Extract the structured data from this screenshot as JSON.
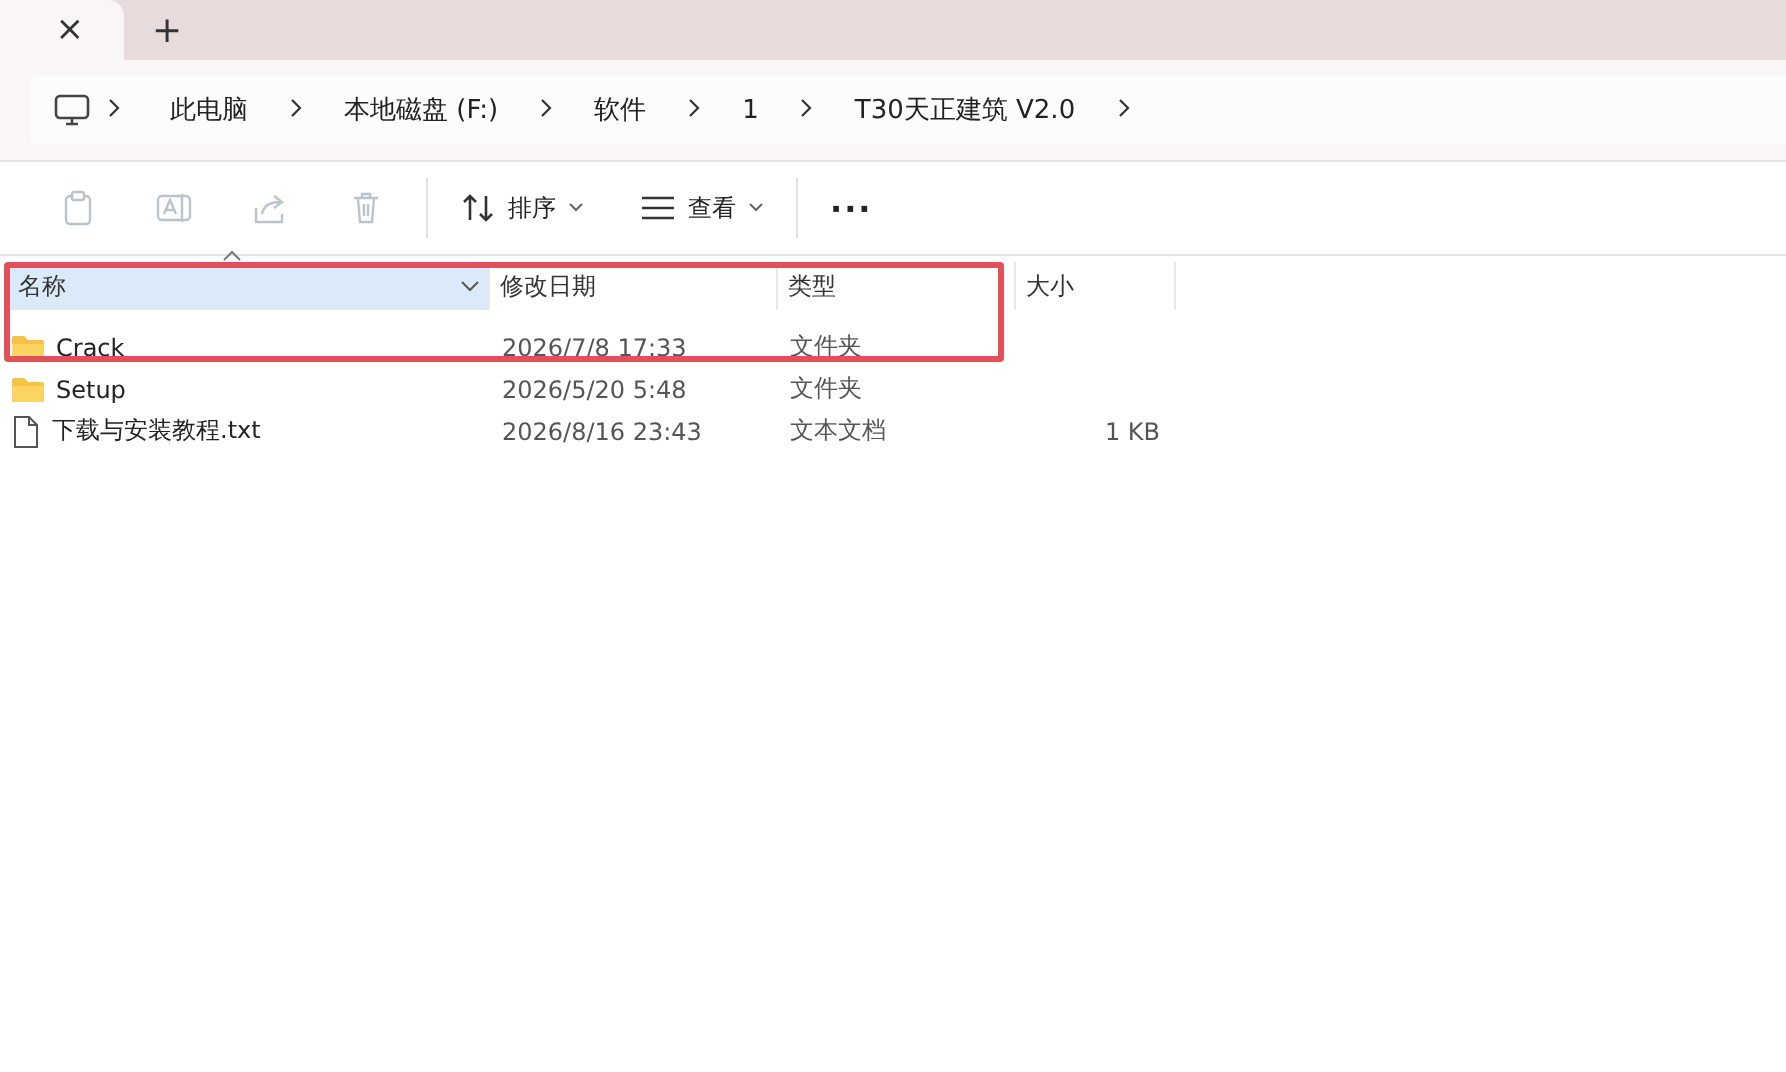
{
  "tabs": [
    {
      "close": "×",
      "selected": true
    }
  ],
  "new_tab": "+",
  "breadcrumb": [
    "此电脑",
    "本地磁盘 (F:)",
    "软件",
    "1",
    "T30天正建筑 V2.0"
  ],
  "toolbar": {
    "actions": [
      {
        "kind": "copy",
        "disabled": true
      },
      {
        "kind": "rename",
        "disabled": true
      },
      {
        "kind": "share",
        "disabled": true
      },
      {
        "kind": "delete",
        "disabled": true
      }
    ],
    "sort": "排序",
    "view": "查看",
    "more": "···"
  },
  "table": {
    "columns": [
      {
        "label": "名称",
        "selected": true
      },
      {
        "label": "修改日期",
        "selected": false
      },
      {
        "label": "类型",
        "selected": false
      },
      {
        "label": "大小",
        "selected": false
      }
    ],
    "rows": [
      {
        "kind": "folder",
        "name": "Crack",
        "date": "2026/7/8 17:33",
        "type": "文件夹",
        "highlighted": true
      },
      {
        "kind": "folder",
        "name": "Setup",
        "date": "2026/5/20 5:48",
        "type": "文件夹",
        "highlighted": false
      },
      {
        "kind": "file",
        "name": "下载与安装教程.txt",
        "date": "2026/8/16 23:43",
        "type": "文本文档",
        "size": "1 KB",
        "highlighted": false
      }
    ]
  }
}
